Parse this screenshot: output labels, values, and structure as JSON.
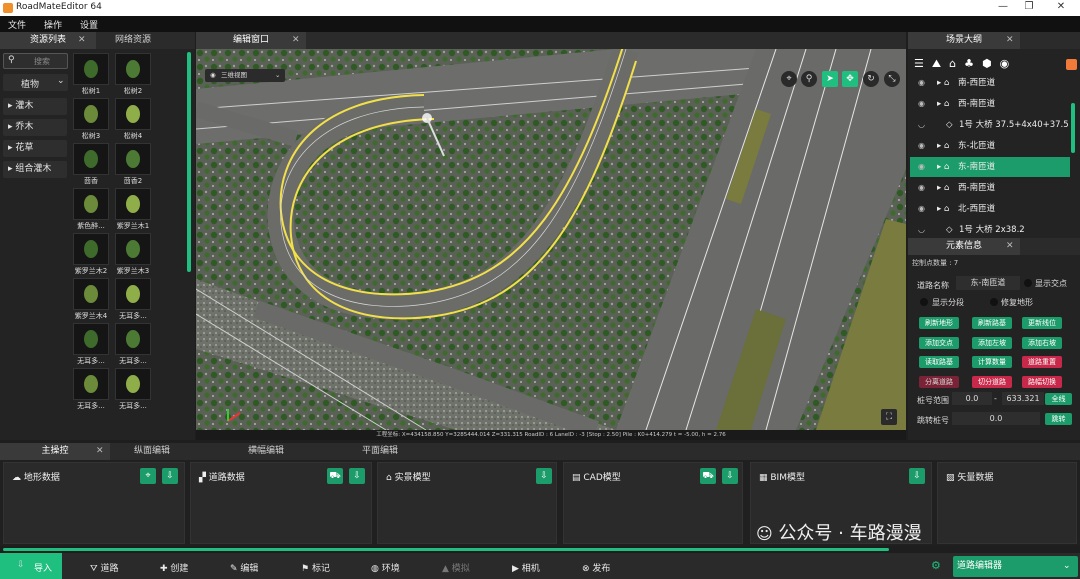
{
  "window": {
    "title": "RoadMateEditor 64"
  },
  "menu": [
    "文件",
    "操作",
    "设置"
  ],
  "left_panel": {
    "tabs": [
      "资源列表",
      "网络资源"
    ],
    "search_placeholder": "搜索",
    "dropdown_value": "植物",
    "categories": [
      "灌木",
      "乔木",
      "花草",
      "组合灌木"
    ],
    "thumbs": [
      "松树1",
      "松树2",
      "松树3",
      "松树4",
      "茴香",
      "茴香2",
      "紫色醉...",
      "紫罗兰木1",
      "紫罗兰木2",
      "紫罗兰木3",
      "紫罗兰木4",
      "无耳多...",
      "无耳多...",
      "无耳多...",
      "无耳多...",
      "无耳多..."
    ]
  },
  "viewport": {
    "tab": "编辑窗口",
    "view_mode": "三维视图",
    "status": "工程坐标: X=434158.850 Y=3285444.014 Z=331.315  RoadID : 6  LaneID : -3 [Stop : 2.50]  Pile : K0+414.279 t = -5.00, h = 2.76"
  },
  "scene_outline": {
    "tab": "场景大纲",
    "rows": [
      {
        "label": "南-西匝道",
        "selected": false
      },
      {
        "label": "西-南匝道",
        "selected": false
      },
      {
        "label": "1号 大桥 37.5+4x40+37.5",
        "selected": false
      },
      {
        "label": "东-北匝道",
        "selected": false
      },
      {
        "label": "东-南匝道",
        "selected": true
      },
      {
        "label": "西-南匝道",
        "selected": false
      },
      {
        "label": "北-西匝道",
        "selected": false
      },
      {
        "label": "1号 大桥 2x38.2",
        "selected": false
      }
    ]
  },
  "element_info": {
    "tab": "元素信息",
    "control_points": "控制点数量 : 7",
    "road_name_label": "道路名称",
    "road_name_value": "东-南匝道",
    "show_intersection": "显示交点",
    "show_segments": "显示分段",
    "repair_terrain": "修复地形",
    "buttons": [
      [
        "刷新地形",
        "刷新路基",
        "更新线位"
      ],
      [
        "添加交点",
        "添加左坡",
        "添加右坡"
      ],
      [
        "读取路基",
        "计算数量",
        "道路重置"
      ],
      [
        "分离道路",
        "切分道路",
        "路幅切换"
      ]
    ],
    "pile_range_label": "桩号范围",
    "pile_from": "0.0",
    "pile_dash": "-",
    "pile_to": "633.321",
    "pile_all": "全线",
    "jump_label": "跳转桩号",
    "jump_value": "0.0",
    "jump_button": "跳转"
  },
  "bottom_tabs": [
    "主操控",
    "纵面编辑",
    "横幅编辑",
    "平面编辑"
  ],
  "cards": [
    "地形数据",
    "道路数据",
    "实景模型",
    "CAD模型",
    "BIM模型",
    "矢量数据"
  ],
  "watermark": "公众号 · 车路漫漫",
  "bottom_bar": [
    "导入",
    "道路",
    "创建",
    "编辑",
    "标记",
    "环境",
    "模拟",
    "相机",
    "发布"
  ],
  "bottom_select": "道路编辑器"
}
